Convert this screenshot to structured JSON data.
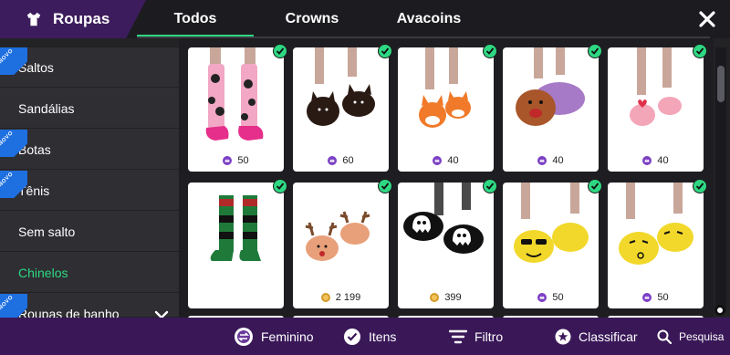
{
  "header": {
    "category_label": "Roupas",
    "tabs": [
      "Todos",
      "Crowns",
      "Avacoins"
    ],
    "active_tab": 0
  },
  "sidebar": {
    "items": [
      {
        "label": "Saltos",
        "badge": "NOVO"
      },
      {
        "label": "Sandálias",
        "badge": ""
      },
      {
        "label": "Botas",
        "badge": "NOVO"
      },
      {
        "label": "Tênis",
        "badge": "NOVO"
      },
      {
        "label": "Sem salto",
        "badge": ""
      },
      {
        "label": "Chinelos",
        "badge": "",
        "active": true
      },
      {
        "label": "Roupas de banho",
        "badge": "NOVO"
      }
    ]
  },
  "items": [
    {
      "name": "pink-spotted-socks",
      "currency": "crowns",
      "price": "50",
      "owned": true
    },
    {
      "name": "black-cat-slippers",
      "currency": "crowns",
      "price": "60",
      "owned": true
    },
    {
      "name": "fox-slippers",
      "currency": "crowns",
      "price": "40",
      "owned": true
    },
    {
      "name": "brown-hedgehog-slippers",
      "currency": "crowns",
      "price": "40",
      "owned": true
    },
    {
      "name": "pink-heart-slides",
      "currency": "crowns",
      "price": "40",
      "owned": true
    },
    {
      "name": "green-striped-socks",
      "currency": "",
      "price": "",
      "owned": true
    },
    {
      "name": "reindeer-slippers",
      "currency": "avacoins",
      "price": "2 199",
      "owned": true
    },
    {
      "name": "ghost-slippers",
      "currency": "avacoins",
      "price": "399",
      "owned": true
    },
    {
      "name": "cool-emoji-slippers",
      "currency": "crowns",
      "price": "50",
      "owned": true
    },
    {
      "name": "kiss-emoji-slippers",
      "currency": "crowns",
      "price": "50",
      "owned": true
    }
  ],
  "bottombar": {
    "gender_label": "Feminino",
    "items_label": "Itens",
    "filter_label": "Filtro",
    "sort_label": "Classificar",
    "search_label": "Pesquisa"
  },
  "colors": {
    "accent": "#2ed883",
    "header_purple": "#3c1c5c",
    "bottombar_purple": "#3a1858",
    "crown_purple": "#7b3fc4",
    "avacoin_gold": "#d49a2a",
    "novo_blue": "#1e6fe0"
  }
}
